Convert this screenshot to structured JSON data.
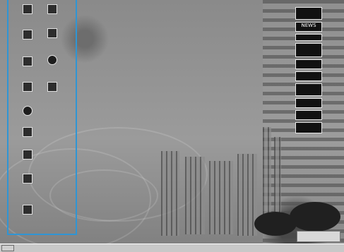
{
  "desktop": {
    "icons": [
      {
        "label": "",
        "name": "icon-top-left",
        "icon": "computer-icon"
      },
      {
        "label": "",
        "name": "icon-top-right",
        "icon": "folder-icon"
      },
      {
        "label": "",
        "name": "icon-inbox",
        "icon": "inbox-icon"
      },
      {
        "label": "",
        "name": "icon-shortcut",
        "icon": "shortcut-icon"
      },
      {
        "label": "",
        "name": "icon-network",
        "icon": "network-icon"
      },
      {
        "label": "",
        "name": "icon-globe",
        "icon": "globe-icon"
      },
      {
        "label": "",
        "name": "icon-people",
        "icon": "people-icon"
      },
      {
        "label": "",
        "name": "icon-building",
        "icon": "building-icon"
      },
      {
        "label": "",
        "name": "icon-globe-2",
        "icon": "globe-icon"
      },
      {
        "label": "",
        "name": "icon-recycle",
        "icon": "recycle-bin-icon"
      },
      {
        "label": "",
        "name": "icon-folder",
        "icon": "folder-icon"
      },
      {
        "label": "",
        "name": "icon-briefcase",
        "icon": "briefcase-icon"
      },
      {
        "label": "",
        "name": "icon-bottom",
        "icon": "app-icon"
      }
    ],
    "widgets": [
      {
        "text": "",
        "name": "widget-1"
      },
      {
        "text": "NEWS",
        "name": "widget-news"
      },
      {
        "text": "",
        "name": "widget-3"
      },
      {
        "text": "",
        "name": "widget-4"
      },
      {
        "text": "",
        "name": "widget-5"
      },
      {
        "text": "",
        "name": "widget-6"
      },
      {
        "text": "",
        "name": "widget-7"
      },
      {
        "text": "",
        "name": "widget-8"
      },
      {
        "text": "",
        "name": "widget-9"
      },
      {
        "text": "",
        "name": "widget-10"
      }
    ]
  },
  "taskbar": {
    "start_label": "",
    "middle_text": "",
    "tray_text": ""
  },
  "floating_panel": {
    "text": ""
  },
  "colors": {
    "selection_border": "#2f95d4",
    "taskbar": "#c8c8c8"
  }
}
